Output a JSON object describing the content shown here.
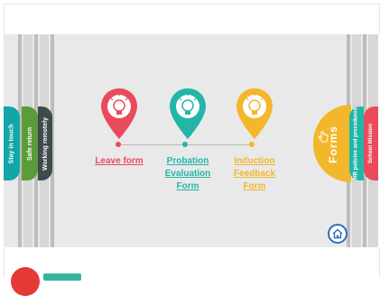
{
  "left_tabs": [
    {
      "label": "Stay in touch",
      "color": "#12a6a6"
    },
    {
      "label": "Safe return",
      "color": "#5b9c3a"
    },
    {
      "label": "Working remotely",
      "color": "#3f4a4a"
    }
  ],
  "pins": [
    {
      "label_lines": [
        "Leave form"
      ],
      "color": "#e94b5c",
      "icon": "lightbulb-icon"
    },
    {
      "label_lines": [
        "Probation",
        "Evaluation",
        "Form"
      ],
      "color": "#23b6a7",
      "icon": "lightbulb-icon"
    },
    {
      "label_lines": [
        "Induction",
        "Feedback",
        "Form"
      ],
      "color": "#f2b72a",
      "icon": "lightbulb-icon"
    }
  ],
  "right_tabs": [
    {
      "label": "Forms",
      "color": "#f2b72a",
      "icon": "hand-pointer-icon"
    },
    {
      "label": "HR policies and procedures",
      "color": "#23b6a7"
    },
    {
      "label": "School Mission",
      "color": "#e94b5c"
    }
  ],
  "home": {
    "icon": "home-icon",
    "color": "#2b6fc2"
  }
}
